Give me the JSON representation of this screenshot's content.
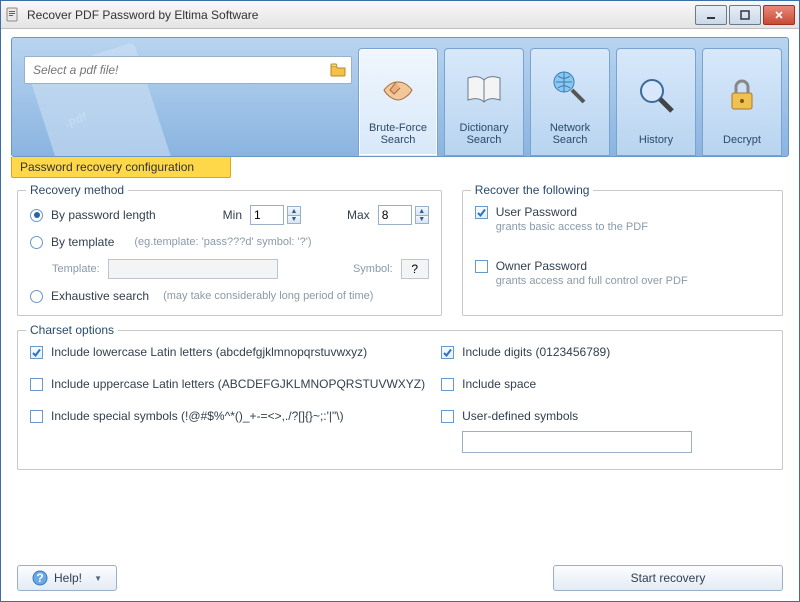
{
  "window": {
    "title": "Recover PDF Password by Eltima Software"
  },
  "filepicker": {
    "placeholder": "Select a pdf file!"
  },
  "tabs": {
    "brute": "Brute-Force Search",
    "dict": "Dictionary Search",
    "net": "Network Search",
    "history": "History",
    "decrypt": "Decrypt"
  },
  "configbar": "Password recovery configuration",
  "recmethod": {
    "legend": "Recovery method",
    "bylen": "By password length",
    "min_lbl": "Min",
    "min_val": "1",
    "max_lbl": "Max",
    "max_val": "8",
    "bytpl": "By template",
    "bytpl_hint": "(eg.template: 'pass???d' symbol: '?')",
    "tpl_lbl": "Template:",
    "sym_lbl": "Symbol:",
    "sym_val": "?",
    "exh": "Exhaustive search",
    "exh_hint": "(may take considerably long period of time)"
  },
  "recfollow": {
    "legend": "Recover the following",
    "user": "User Password",
    "user_hint": "grants basic access to the PDF",
    "owner": "Owner Password",
    "owner_hint": "grants access and full control over PDF"
  },
  "charset": {
    "legend": "Charset options",
    "lower": "Include lowercase Latin letters (abcdefgjklmnopqrstuvwxyz)",
    "upper": "Include uppercase Latin letters (ABCDEFGJKLMNOPQRSTUVWXYZ)",
    "special": "Include special symbols (!@#$%^*()_+-=<>,./?[]{}~;:'|\"\\)",
    "digits": "Include digits (0123456789)",
    "space": "Include space",
    "userdef": "User-defined symbols"
  },
  "footer": {
    "help": "Help!",
    "start": "Start recovery"
  }
}
